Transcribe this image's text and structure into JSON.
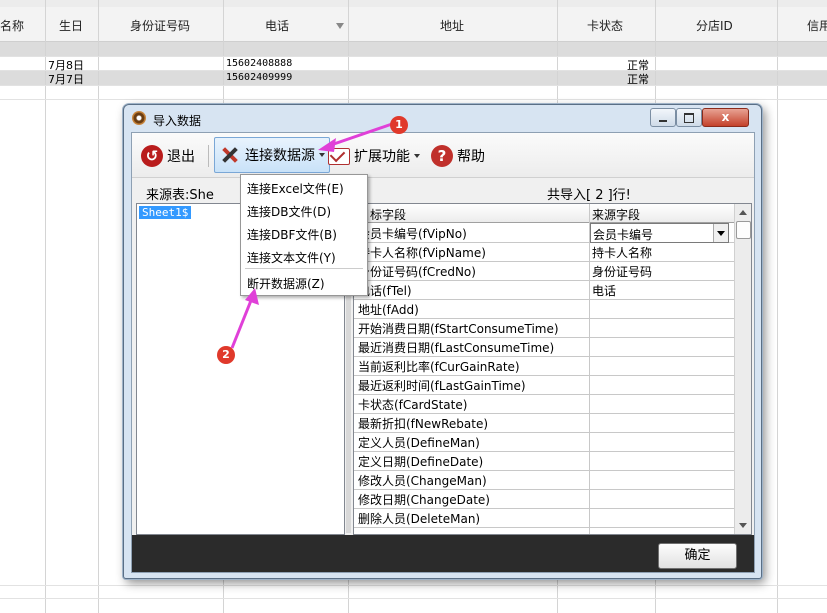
{
  "spreadsheet": {
    "columns": [
      "名称",
      "生日",
      "身份证号码",
      "电话",
      "地址",
      "卡状态",
      "分店ID",
      "信用"
    ],
    "rows": [
      {
        "birthday": "7月8日",
        "phone": "15602408888",
        "status": "正常"
      },
      {
        "birthday": "7月7日",
        "phone": "15602409999",
        "status": "正常"
      }
    ]
  },
  "dialog": {
    "title": "导入数据",
    "close_glyph": "x",
    "toolbar": {
      "exit": "退出",
      "connect": "连接数据源",
      "extend": "扩展功能",
      "help": "帮助"
    },
    "source_label": "来源表:She",
    "import_count": "共导入[ 2 ]行!",
    "source_tables": [
      "Sheet1$"
    ],
    "mapping_headers": {
      "target": "目标字段",
      "source": "来源字段"
    },
    "mapping_rows": [
      {
        "target": "会员卡编号(fVipNo)",
        "source": "会员卡编号"
      },
      {
        "target": "持卡人名称(fVipName)",
        "source": "持卡人名称"
      },
      {
        "target": "身份证号码(fCredNo)",
        "source": "身份证号码"
      },
      {
        "target": "电话(fTel)",
        "source": "电话"
      },
      {
        "target": "地址(fAdd)",
        "source": ""
      },
      {
        "target": "开始消费日期(fStartConsumeTime)",
        "source": ""
      },
      {
        "target": "最近消费日期(fLastConsumeTime)",
        "source": ""
      },
      {
        "target": "当前返利比率(fCurGainRate)",
        "source": ""
      },
      {
        "target": "最近返利时间(fLastGainTime)",
        "source": ""
      },
      {
        "target": "卡状态(fCardState)",
        "source": ""
      },
      {
        "target": "最新折扣(fNewRebate)",
        "source": ""
      },
      {
        "target": "定义人员(DefineMan)",
        "source": ""
      },
      {
        "target": "定义日期(DefineDate)",
        "source": ""
      },
      {
        "target": "修改人员(ChangeMan)",
        "source": ""
      },
      {
        "target": "修改日期(ChangeDate)",
        "source": ""
      },
      {
        "target": "删除人员(DeleteMan)",
        "source": ""
      }
    ],
    "ok": "确定"
  },
  "menu": {
    "items": [
      "连接Excel文件(E)",
      "连接DB文件(D)",
      "连接DBF文件(B)",
      "连接文本文件(Y)",
      "断开数据源(Z)"
    ]
  },
  "annotations": {
    "badge1": "1",
    "badge2": "2",
    "color": "#e040d8"
  }
}
